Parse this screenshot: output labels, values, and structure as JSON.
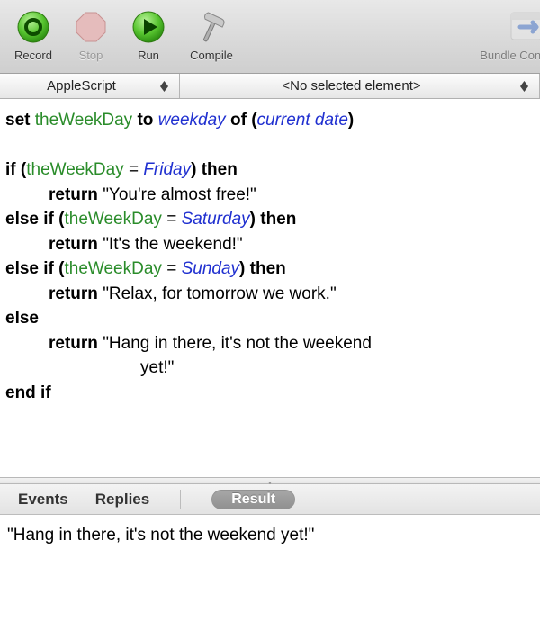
{
  "toolbar": {
    "record": "Record",
    "stop": "Stop",
    "run": "Run",
    "compile": "Compile",
    "bundle": "Bundle Conte"
  },
  "dropdowns": {
    "language": "AppleScript",
    "element": "<No selected element>"
  },
  "code": {
    "line1_set": "set",
    "line1_var": "theWeekDay",
    "line1_to": "to",
    "line1_cmd": "weekday",
    "line1_of": "of",
    "line1_call": "current date",
    "if": "if",
    "elseif": "else if",
    "else": "else",
    "then": "then",
    "return": "return",
    "endif": "end if",
    "eq": "=",
    "var": "theWeekDay",
    "day_fri": "Friday",
    "day_sat": "Saturday",
    "day_sun": "Sunday",
    "str_fri": "\"You're almost free!\"",
    "str_sat": "\"It's the weekend!\"",
    "str_sun": "\"Relax, for tomorrow we work.\"",
    "str_else_a": "\"Hang in there, it's not the weekend",
    "str_else_b": "yet!\""
  },
  "tabs": {
    "events": "Events",
    "replies": "Replies",
    "result": "Result"
  },
  "result": {
    "text": "\"Hang in there, it's not the weekend yet!\""
  }
}
